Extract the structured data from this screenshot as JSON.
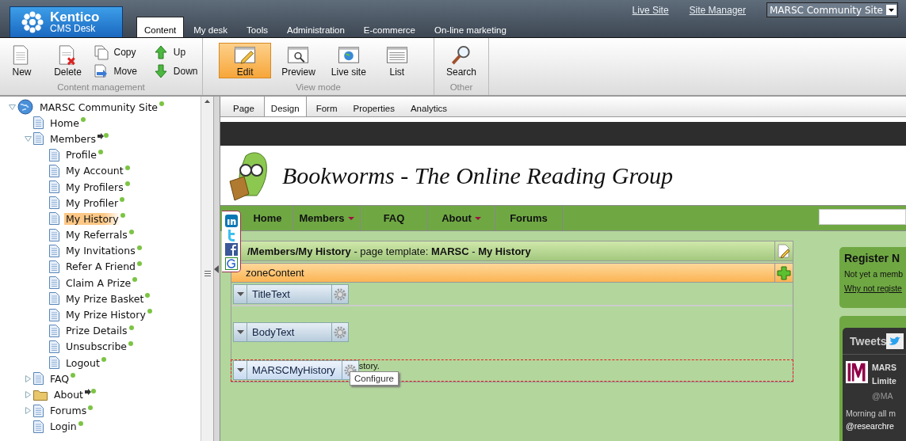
{
  "header": {
    "logo": {
      "title": "Kentico",
      "subtitle": "CMS Desk"
    },
    "links": [
      "Live Site",
      "Site Manager"
    ],
    "site_selector": {
      "value": "MARSC Community Site"
    },
    "tabs": [
      {
        "label": "Content",
        "selected": true
      },
      {
        "label": "My desk",
        "selected": false
      },
      {
        "label": "Tools",
        "selected": false
      },
      {
        "label": "Administration",
        "selected": false
      },
      {
        "label": "E-commerce",
        "selected": false
      },
      {
        "label": "On-line marketing",
        "selected": false
      }
    ]
  },
  "toolbar": {
    "groups": [
      {
        "label": "Content management",
        "buttons": [
          {
            "label": "New",
            "kind": "large",
            "selected": false
          },
          {
            "label": "Delete",
            "kind": "large",
            "selected": false
          },
          {
            "label": "Copy",
            "kind": "small",
            "selected": false
          },
          {
            "label": "Move",
            "kind": "small",
            "selected": false
          },
          {
            "label": "Up",
            "kind": "small",
            "selected": false
          },
          {
            "label": "Down",
            "kind": "small",
            "selected": false
          }
        ]
      },
      {
        "label": "View mode",
        "buttons": [
          {
            "label": "Edit",
            "kind": "large",
            "selected": true
          },
          {
            "label": "Preview",
            "kind": "large",
            "selected": false
          },
          {
            "label": "Live site",
            "kind": "large",
            "selected": false
          },
          {
            "label": "List",
            "kind": "large",
            "selected": false
          }
        ]
      },
      {
        "label": "Other",
        "buttons": [
          {
            "label": "Search",
            "kind": "large",
            "selected": false
          }
        ]
      }
    ]
  },
  "tree": [
    {
      "label": "MARSC Community Site",
      "kind": "root",
      "expanded": true,
      "selected": false,
      "children": [
        {
          "label": "Home",
          "kind": "page",
          "selected": false
        },
        {
          "label": "Members",
          "kind": "page",
          "expanded": true,
          "linked": true,
          "selected": false,
          "children": [
            {
              "label": "Profile",
              "kind": "page",
              "selected": false
            },
            {
              "label": "My Account",
              "kind": "page",
              "selected": false
            },
            {
              "label": "My Profilers",
              "kind": "page",
              "selected": false
            },
            {
              "label": "My Profiler",
              "kind": "page",
              "selected": false
            },
            {
              "label": "My History",
              "kind": "page",
              "selected": true
            },
            {
              "label": "My Referrals",
              "kind": "page",
              "selected": false
            },
            {
              "label": "My Invitations",
              "kind": "page",
              "selected": false
            },
            {
              "label": "Refer A Friend",
              "kind": "page",
              "selected": false
            },
            {
              "label": "Claim A Prize",
              "kind": "page",
              "selected": false
            },
            {
              "label": "My Prize Basket",
              "kind": "page",
              "selected": false
            },
            {
              "label": "My Prize History",
              "kind": "page",
              "selected": false
            },
            {
              "label": "Prize Details",
              "kind": "page",
              "selected": false
            },
            {
              "label": "Unsubscribe",
              "kind": "page",
              "selected": false
            },
            {
              "label": "Logout",
              "kind": "page",
              "selected": false
            }
          ]
        },
        {
          "label": "FAQ",
          "kind": "page",
          "expanded": false,
          "selected": false
        },
        {
          "label": "About",
          "kind": "folder",
          "expanded": false,
          "linked": true,
          "selected": false
        },
        {
          "label": "Forums",
          "kind": "page",
          "expanded": false,
          "selected": false
        },
        {
          "label": "Login",
          "kind": "page",
          "selected": false
        }
      ]
    }
  ],
  "editor_tabs": [
    {
      "label": "Page",
      "selected": false
    },
    {
      "label": "Design",
      "selected": true
    },
    {
      "label": "Form",
      "selected": false
    },
    {
      "label": "Properties",
      "selected": false
    },
    {
      "label": "Analytics",
      "selected": false
    }
  ],
  "site": {
    "title": "Bookworms - The Online Reading Group",
    "nav": [
      {
        "label": "Home",
        "has_menu": false
      },
      {
        "label": "Members",
        "has_menu": true
      },
      {
        "label": "FAQ",
        "has_menu": false
      },
      {
        "label": "About",
        "has_menu": true
      },
      {
        "label": "Forums",
        "has_menu": false
      }
    ],
    "template_header": "**/Members/My History** - page template: **MARSC** - **My History**",
    "zone": "zoneContent",
    "webparts": [
      {
        "label": "TitleText",
        "selected": false
      },
      {
        "label": "BodyText",
        "selected": false
      },
      {
        "label": "MARSCMyHistory",
        "selected": true,
        "content": "story."
      }
    ],
    "tooltip": "Configure",
    "register": {
      "title": "Register N",
      "text": "Not yet a memb",
      "link": "Why not registe"
    },
    "tweets": {
      "title": "Tweets",
      "author": [
        "MARS",
        "Limite"
      ],
      "handle": "@MA",
      "text": [
        "Morning all m",
        "@researchre"
      ]
    }
  }
}
